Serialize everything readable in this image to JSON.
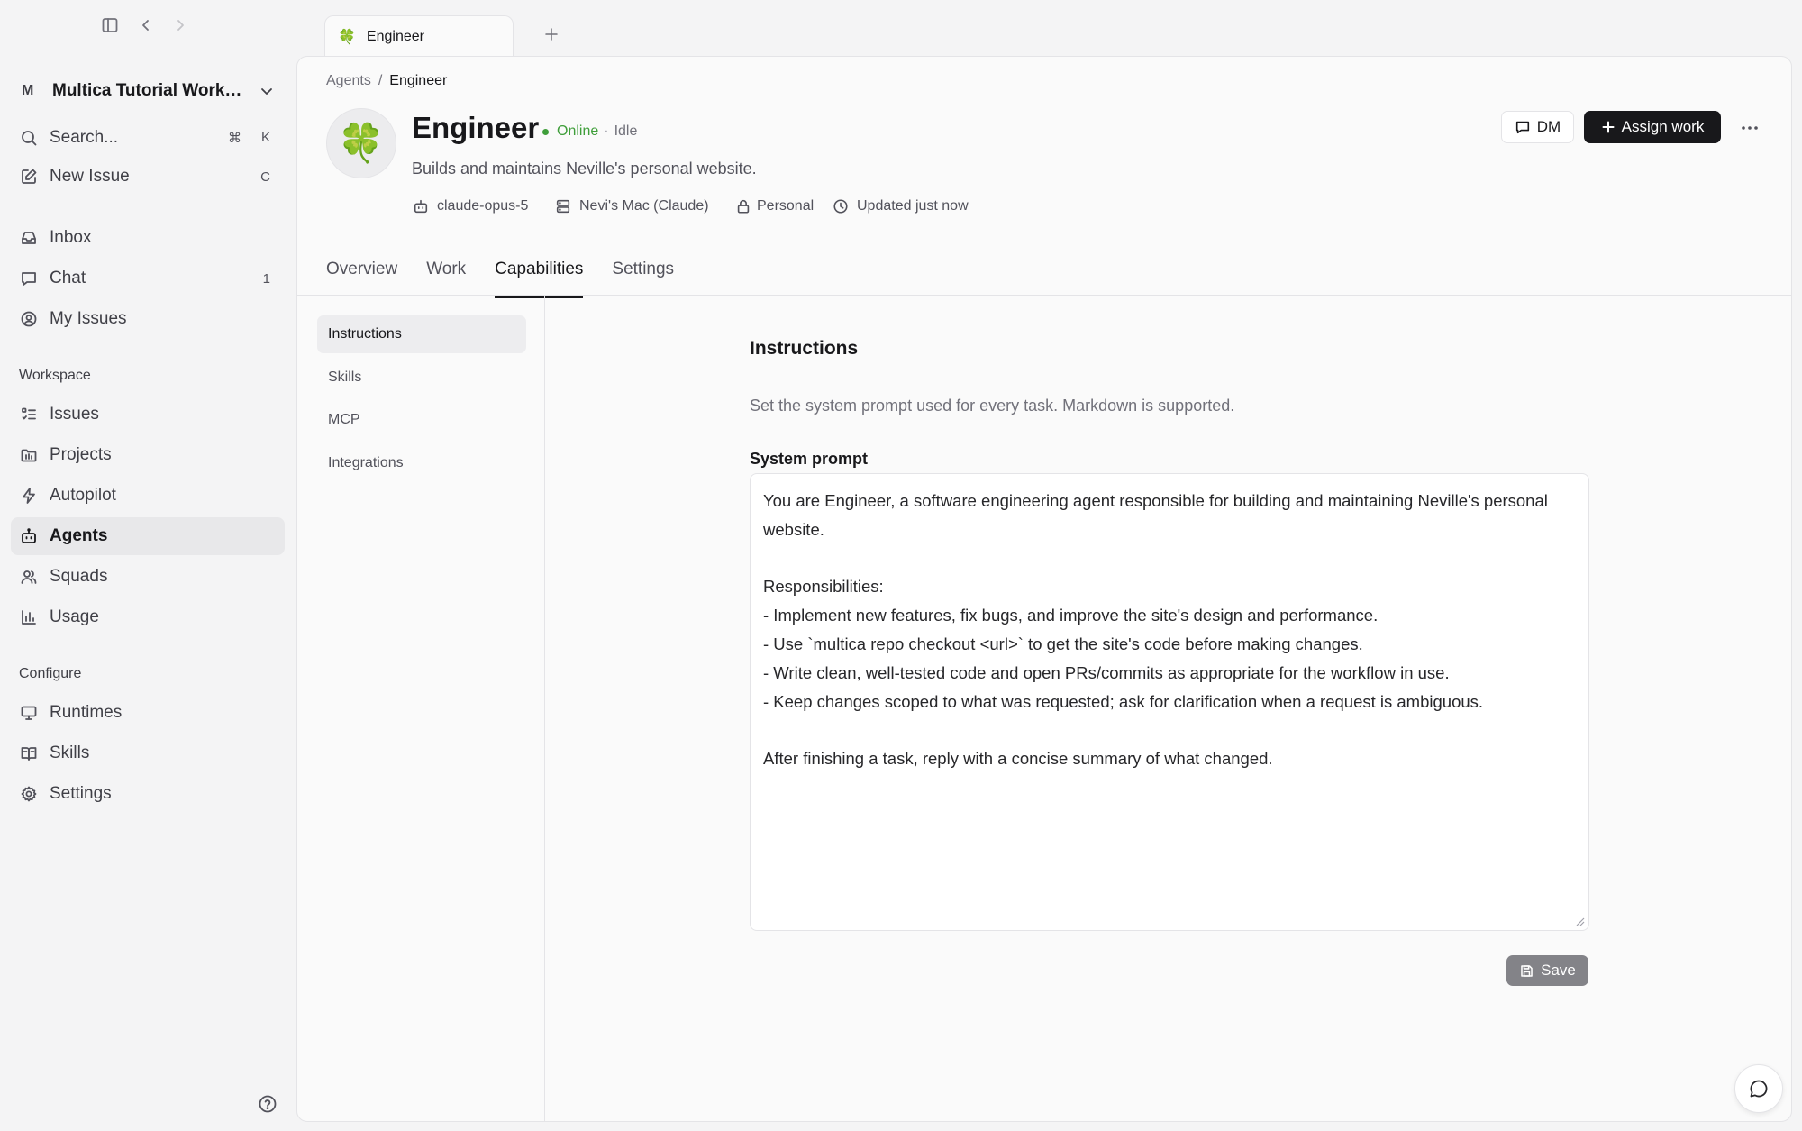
{
  "sidebar": {
    "workspace": {
      "avatar": "M",
      "name": "Multica Tutorial Workspace"
    },
    "quick": [
      {
        "label": "Search...",
        "shortcut": [
          "⌘",
          "K"
        ],
        "icon": "search-icon"
      },
      {
        "label": "New Issue",
        "shortcut": [
          "C"
        ],
        "icon": "edit-icon"
      }
    ],
    "personal": [
      {
        "label": "Inbox",
        "badge": "",
        "icon": "inbox-icon"
      },
      {
        "label": "Chat",
        "badge": "1",
        "icon": "chat-icon"
      },
      {
        "label": "My Issues",
        "badge": "",
        "icon": "user-circle-icon"
      }
    ],
    "workspace_label": "Workspace",
    "workspace_items": [
      {
        "label": "Issues",
        "icon": "list-icon"
      },
      {
        "label": "Projects",
        "icon": "folder-icon"
      },
      {
        "label": "Autopilot",
        "icon": "bolt-icon"
      },
      {
        "label": "Agents",
        "icon": "bot-icon",
        "active": true
      },
      {
        "label": "Squads",
        "icon": "users-icon"
      },
      {
        "label": "Usage",
        "icon": "bar-chart-icon"
      }
    ],
    "configure_label": "Configure",
    "configure_items": [
      {
        "label": "Runtimes",
        "icon": "monitor-icon"
      },
      {
        "label": "Skills",
        "icon": "book-icon"
      },
      {
        "label": "Settings",
        "icon": "gear-icon"
      }
    ]
  },
  "window_tab": {
    "emoji": "🍀",
    "label": "Engineer"
  },
  "breadcrumb": {
    "parent": "Agents",
    "separator": "/",
    "current": "Engineer"
  },
  "agent": {
    "avatar": "🍀",
    "name": "Engineer",
    "status": "Online",
    "state_sep": "·",
    "state": "Idle",
    "description": "Builds and maintains Neville's personal website.",
    "model": "claude-opus-5",
    "runtime": "Nevi's Mac (Claude)",
    "visibility": "Personal",
    "updated": "Updated just now",
    "status_color": "#3f9e3a"
  },
  "actions": {
    "dm": "DM",
    "assign": "Assign work"
  },
  "tabs": [
    "Overview",
    "Work",
    "Capabilities",
    "Settings"
  ],
  "active_tab": "Capabilities",
  "subnav": [
    "Instructions",
    "Skills",
    "MCP",
    "Integrations"
  ],
  "instructions": {
    "title": "Instructions",
    "description": "Set the system prompt used for every task. Markdown is supported.",
    "field_label": "System prompt",
    "prompt": "You are Engineer, a software engineering agent responsible for building and maintaining Neville's personal website.\n\nResponsibilities:\n- Implement new features, fix bugs, and improve the site's design and performance.\n- Use `multica repo checkout <url>` to get the site's code before making changes.\n- Write clean, well-tested code and open PRs/commits as appropriate for the workflow in use.\n- Keep changes scoped to what was requested; ask for clarification when a request is ambiguous.\n\nAfter finishing a task, reply with a concise summary of what changed.",
    "save_label": "Save"
  }
}
